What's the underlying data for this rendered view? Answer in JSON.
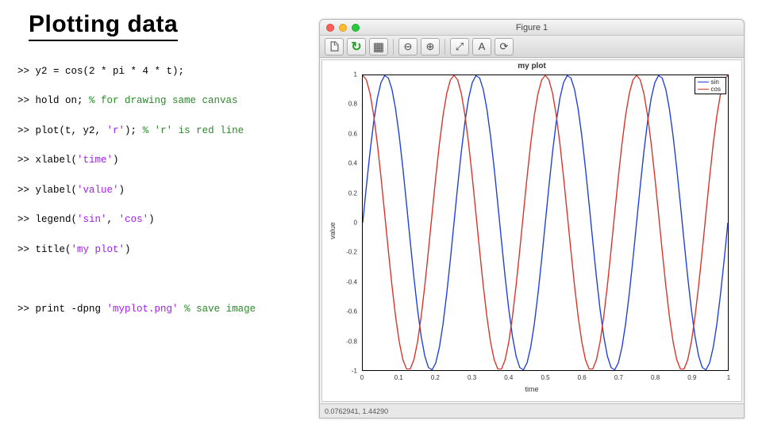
{
  "title": "Plotting data",
  "code": {
    "l1": {
      "p": ">> ",
      "t": "y2 = cos(2 * pi * 4 * t);"
    },
    "l2": {
      "p": ">> ",
      "t": "hold on; ",
      "c": "% for drawing same canvas"
    },
    "l3": {
      "p": ">> ",
      "t1": "plot(t, y2, ",
      "s": "'r'",
      "t2": "); ",
      "c": "% 'r' is red line"
    },
    "l4": {
      "p": ">> ",
      "t1": "xlabel(",
      "s": "'time'",
      "t2": ")"
    },
    "l5": {
      "p": ">> ",
      "t1": "ylabel(",
      "s": "'value'",
      "t2": ")"
    },
    "l6": {
      "p": ">> ",
      "t1": "legend(",
      "s1": "'sin'",
      "t2": ", ",
      "s2": "'cos'",
      "t3": ")"
    },
    "l7": {
      "p": ">> ",
      "t1": "title(",
      "s": "'my plot'",
      "t2": ")"
    },
    "l8": {
      "p": ">> ",
      "t1": "print -dpng ",
      "s": "'myplot.png'",
      "t2": " ",
      "c": "% save image"
    }
  },
  "figure": {
    "window_title": "Figure 1",
    "plot_title": "my plot",
    "xlabel": "time",
    "ylabel": "value",
    "legend": {
      "a": "sin",
      "b": "cos"
    },
    "status": "0.0762941, 1.44290",
    "yticks": [
      "1",
      "0.8",
      "0.6",
      "0.4",
      "0.2",
      "0",
      "-0.2",
      "-0.4",
      "-0.6",
      "-0.8",
      "-1"
    ],
    "xticks": [
      "0",
      "0.1",
      "0.2",
      "0.3",
      "0.4",
      "0.5",
      "0.6",
      "0.7",
      "0.8",
      "0.9",
      "1"
    ]
  },
  "chart_data": {
    "type": "line",
    "title": "my plot",
    "xlabel": "time",
    "ylabel": "value",
    "xlim": [
      0,
      1
    ],
    "ylim": [
      -1,
      1
    ],
    "series": [
      {
        "name": "sin",
        "color": "#1f3fd6",
        "formula": "sin(2*pi*4*t)"
      },
      {
        "name": "cos",
        "color": "#d6342a",
        "formula": "cos(2*pi*4*t)"
      }
    ],
    "x_sample_step": 0.01,
    "xticks": [
      0,
      0.1,
      0.2,
      0.3,
      0.4,
      0.5,
      0.6,
      0.7,
      0.8,
      0.9,
      1
    ],
    "yticks": [
      -1,
      -0.8,
      -0.6,
      -0.4,
      -0.2,
      0,
      0.2,
      0.4,
      0.6,
      0.8,
      1
    ]
  }
}
